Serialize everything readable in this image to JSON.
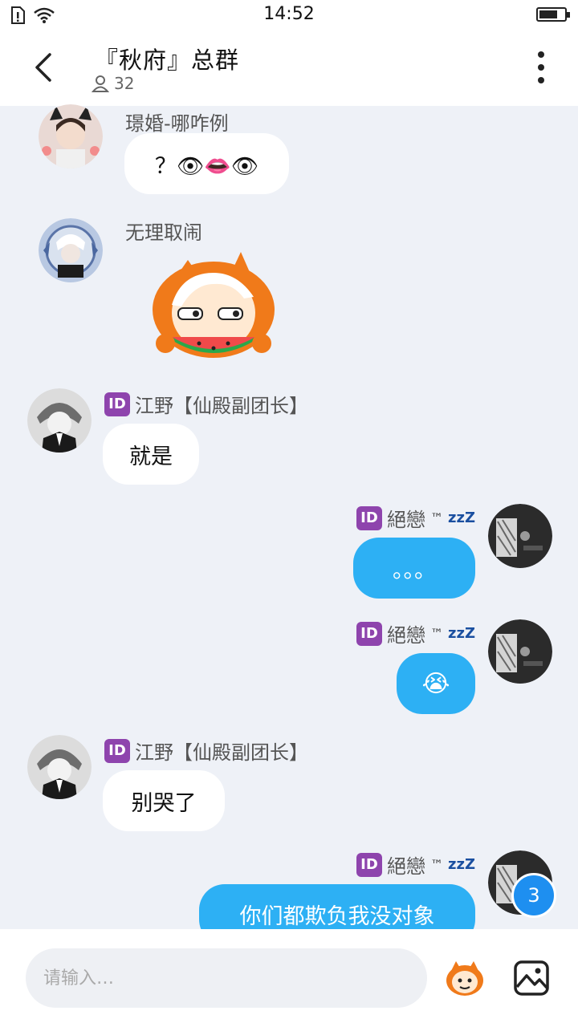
{
  "status_bar": {
    "time": "14:52"
  },
  "header": {
    "title": "『秋府』总群",
    "member_count": "32"
  },
  "messages": [
    {
      "sender": "璟婚-哪咋例",
      "text": "？👁👄👁"
    },
    {
      "sender": "无理取闹",
      "sticker": "watermelon-eating-sticker"
    },
    {
      "sender_badge": "ID",
      "sender": "江野【仙殿副团长】",
      "text": "就是"
    },
    {
      "sender_badge": "ID",
      "sender": "絕戀",
      "sender_tm": "™",
      "sender_zzz": "zzZ",
      "text": "。。。"
    },
    {
      "sender_badge": "ID",
      "sender": "絕戀",
      "sender_tm": "™",
      "sender_zzz": "zzZ",
      "text": "😭"
    },
    {
      "sender_badge": "ID",
      "sender": "江野【仙殿副团长】",
      "text": "别哭了"
    },
    {
      "sender_badge": "ID",
      "sender": "絕戀",
      "sender_tm": "™",
      "sender_zzz": "zzZ",
      "text": "你们都欺负我没对象"
    }
  ],
  "unread_badge": "3",
  "input": {
    "placeholder": "请输入…"
  },
  "colors": {
    "bubble_out": "#2db0f4",
    "unread": "#1e8ff0",
    "background": "#eef1f7"
  }
}
